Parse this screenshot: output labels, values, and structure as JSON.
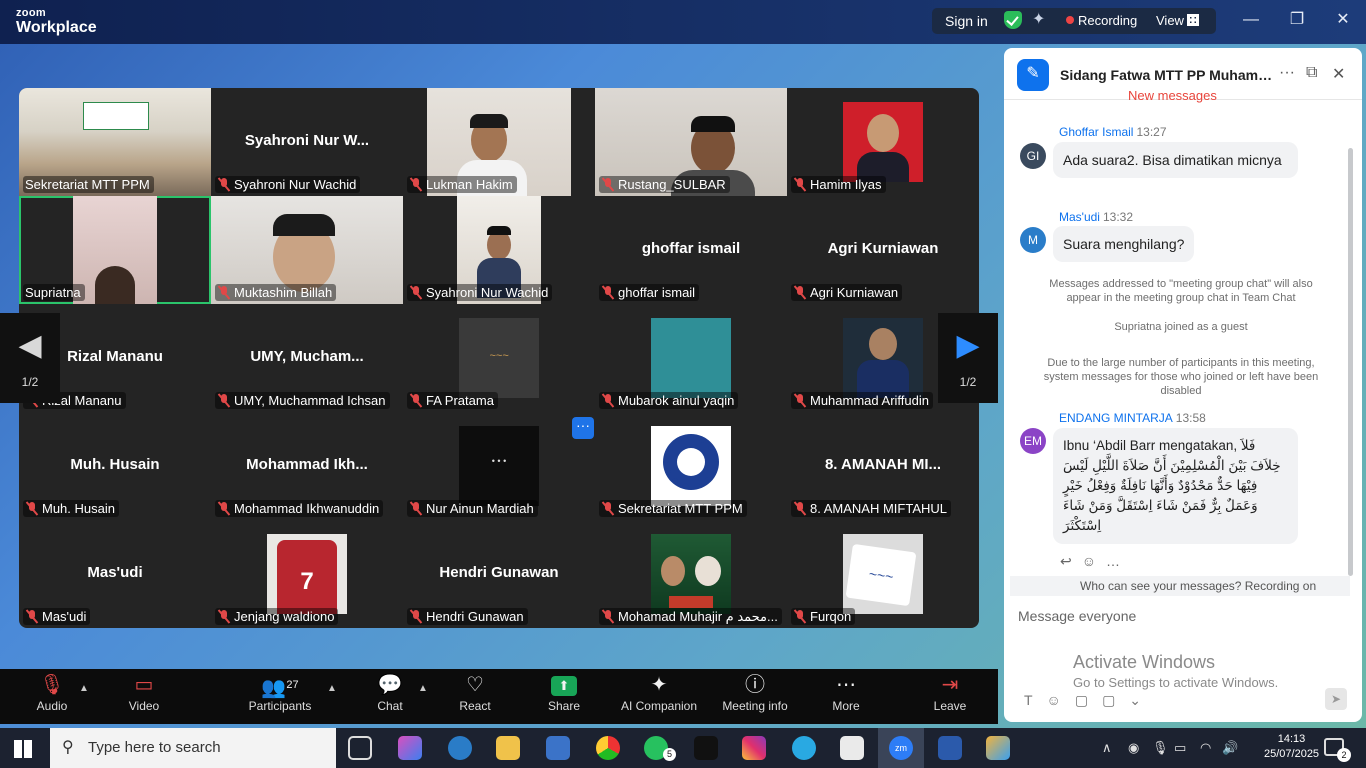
{
  "app": {
    "logo_line1": "zoom",
    "logo_line2": "Workplace",
    "sign_in": "Sign in",
    "recording": "Recording",
    "view": "View"
  },
  "window_controls": {
    "minimize": "—",
    "restore": "❐",
    "close": "✕"
  },
  "gallery": {
    "page_indicator": "1/2",
    "tiles": [
      {
        "name": "Sekretariat MTT PPM",
        "big": "",
        "type": "photo"
      },
      {
        "name": "Syahroni Nur Wachid",
        "big": "Syahroni Nur W...",
        "type": "name"
      },
      {
        "name": "Lukman Hakim",
        "big": "",
        "type": "video"
      },
      {
        "name": "Rustang_SULBAR",
        "big": "",
        "type": "video"
      },
      {
        "name": "Hamim Ilyas",
        "big": "",
        "type": "avatar"
      },
      {
        "name": "Supriatna",
        "big": "",
        "type": "video"
      },
      {
        "name": "Muktashim Billah",
        "big": "",
        "type": "video"
      },
      {
        "name": "Syahroni Nur Wachid",
        "big": "",
        "type": "video"
      },
      {
        "name": "ghoffar ismail",
        "big": "ghoffar ismail",
        "type": "name"
      },
      {
        "name": "Agri Kurniawan",
        "big": "Agri Kurniawan",
        "type": "name"
      },
      {
        "name": "Rizal Mananu",
        "big": "Rizal Mananu",
        "type": "name"
      },
      {
        "name": "UMY, Muchammad Ichsan",
        "big": "UMY,  Mucham...",
        "type": "name"
      },
      {
        "name": "FA Pratama",
        "big": "",
        "type": "avatar"
      },
      {
        "name": "Mubarok ainul yaqin",
        "big": "",
        "type": "avatar"
      },
      {
        "name": "Muhammad Ariffudin",
        "big": "",
        "type": "avatar"
      },
      {
        "name": "Muh. Husain",
        "big": "Muh. Husain",
        "type": "name"
      },
      {
        "name": "Mohammad Ikhwanuddin",
        "big": "Mohammad  Ikh...",
        "type": "name"
      },
      {
        "name": "Nur Ainun Mardiah",
        "big": "",
        "type": "avatar"
      },
      {
        "name": "Sekretariat MTT PPM",
        "big": "",
        "type": "avatar"
      },
      {
        "name": "8. AMANAH MIFTAHUL",
        "big": "8. AMANAH MI...",
        "type": "name"
      },
      {
        "name": "Mas'udi",
        "big": "Mas'udi",
        "type": "name"
      },
      {
        "name": "Jenjang waldiono",
        "big": "",
        "type": "avatar"
      },
      {
        "name": "Hendri Gunawan",
        "big": "Hendri Gunawan",
        "type": "name"
      },
      {
        "name": "Mohamad Muhajir محمد م...",
        "big": "",
        "type": "avatar"
      },
      {
        "name": "Furqon",
        "big": "",
        "type": "avatar"
      }
    ]
  },
  "chat": {
    "title": "Sidang Fatwa MTT PP Muhamm...",
    "new_messages": "New messages",
    "messages": [
      {
        "initials": "GI",
        "sender": "Ghoffar Ismail",
        "time": "13:27",
        "text": "Ada suara2. Bisa dimatikan micnya",
        "color": "#3a4a5e"
      },
      {
        "initials": "M",
        "sender": "Mas'udi",
        "time": "13:32",
        "text": "Suara menghilang?",
        "color": "#2a7dc9"
      },
      {
        "initials": "EM",
        "sender": "ENDANG MINTARJA",
        "time": "13:58",
        "text": "Ibnu ‘Abdil Barr mengatakan, فَلاَ خِلاَفَ بَيْنَ الْمُسْلِمِيْنَ أَنَّ صَلاَةَ اللَّيْلِ لَيْسَ فِيْهَا حَدٌّ مَحْدُوْدٌ وَأَنَّهَا نَافِلَةٌ وَفِعْلُ خَيْرٍ وَعَمَلٌ بِرٌّ فَمَنْ شَاءَ اِسْتَقَلَّ وَمَنْ شَاءَ اِسْتَكْثَرَ",
        "color": "#8b44c6"
      }
    ],
    "system1": "Messages addressed to \"meeting group chat\" will also appear in the meeting group chat in Team Chat",
    "system2": "Supriatna joined as a guest",
    "system3": "Due to the large number of participants in this meeting, system messages for those who joined or left have been disabled",
    "who_can_see": "Who can see your messages? Recording on",
    "input_placeholder": "Message everyone"
  },
  "watermark": {
    "line1": "Activate Windows",
    "line2": "Go to Settings to activate Windows."
  },
  "toolbar": {
    "audio": "Audio",
    "video": "Video",
    "participants": "Participants",
    "participant_count": "27",
    "chat": "Chat",
    "react": "React",
    "share": "Share",
    "ai": "AI Companion",
    "info": "Meeting info",
    "more": "More",
    "leave": "Leave"
  },
  "taskbar": {
    "search": "Type here to search",
    "time": "14:13",
    "date": "25/07/2025",
    "whatsapp_badge": "5",
    "notif_count": "2"
  }
}
